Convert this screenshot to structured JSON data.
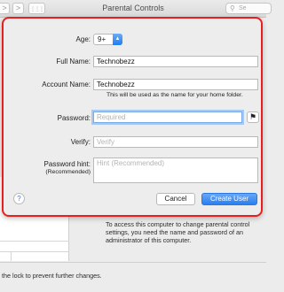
{
  "window": {
    "title": "Parental Controls",
    "search_icon": "magnifier-icon",
    "search_placeholder": "Se"
  },
  "toolbar": {
    "back_glyph": ">",
    "forward_glyph": ">",
    "grid_glyph": "⋮⋮⋮"
  },
  "form": {
    "age_label": "Age:",
    "age_value": "9+",
    "full_name_label": "Full Name:",
    "full_name_value": "Technobezz",
    "account_name_label": "Account Name:",
    "account_name_value": "Technobezz",
    "account_name_hint": "This will be used as the name for your home folder.",
    "password_label": "Password:",
    "password_placeholder": "Required",
    "verify_label": "Verify:",
    "verify_placeholder": "Verify",
    "password_hint_label": "Password hint:",
    "password_hint_sublabel": "(Recommended)",
    "password_hint_placeholder": "Hint (Recommended)"
  },
  "buttons": {
    "help": "?",
    "cancel": "Cancel",
    "create_user": "Create User",
    "key_icon": "key-icon"
  },
  "background": {
    "info_text": "To access this computer to change parental control settings, you need the name and password of an administrator of this computer.",
    "lock_text": "the lock to prevent further changes."
  },
  "colors": {
    "highlight_border": "#e7201f",
    "accent": "#2a7ef0"
  }
}
